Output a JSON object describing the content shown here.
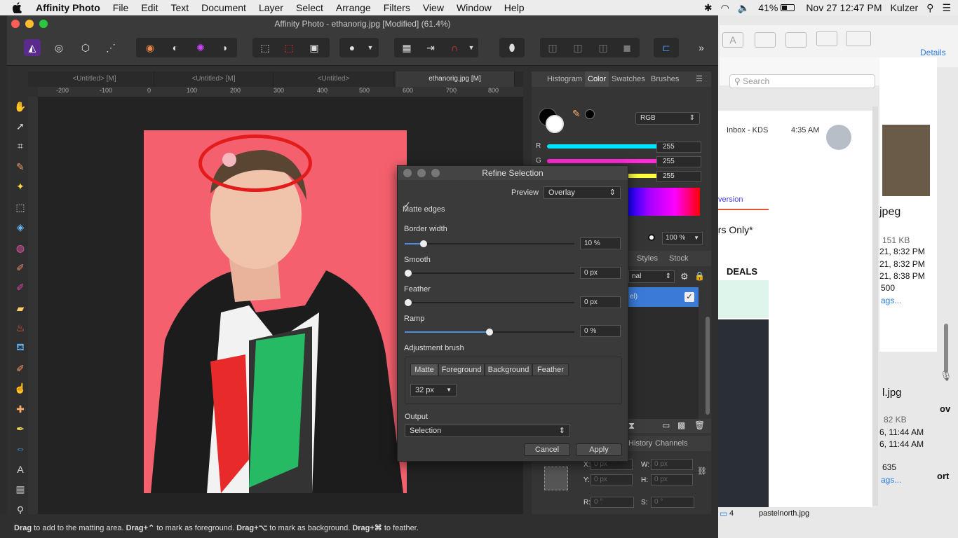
{
  "menubar": {
    "app_name": "Affinity Photo",
    "menus": [
      "File",
      "Edit",
      "Text",
      "Document",
      "Layer",
      "Select",
      "Arrange",
      "Filters",
      "View",
      "Window",
      "Help"
    ],
    "battery": "41%",
    "clock": "Nov 27  12:47 PM",
    "user": "Kulzer"
  },
  "window": {
    "title": "Affinity Photo - ethanorig.jpg [Modified] (61.4%)"
  },
  "doc_tabs": [
    "<Untitled> [M]",
    "<Untitled> [M]",
    "<Untitled>",
    "ethanorig.jpg [M]"
  ],
  "ruler": {
    "unit": "px",
    "ticks": [
      "-200",
      "-100",
      "0",
      "100",
      "200",
      "300",
      "400",
      "500",
      "600",
      "700",
      "800"
    ]
  },
  "color_panel": {
    "tabs": [
      "Histogram",
      "Color",
      "Swatches",
      "Brushes"
    ],
    "mode": "RGB",
    "channels": [
      {
        "label": "R",
        "value": "255",
        "color": "#00e5ff"
      },
      {
        "label": "G",
        "value": "255",
        "color": "#ff2bd6"
      },
      {
        "label": "B",
        "value": "255",
        "color": "#ffff40"
      }
    ],
    "opacity": "100 %"
  },
  "layers_panel": {
    "tabs": [
      "Styles",
      "Stock"
    ],
    "blend_fragment": "nal",
    "layer_fragment": "el)"
  },
  "transform_panel": {
    "tabs": [
      "History",
      "Channels"
    ],
    "x_label": "X:",
    "x_ph": "0 px",
    "y_label": "Y:",
    "y_ph": "0 px",
    "w_label": "W:",
    "w_ph": "0 px",
    "h_label": "H:",
    "h_ph": "0 px",
    "r_label": "R:",
    "r_ph": "0 °",
    "s_label": "S:",
    "s_ph": "0 °"
  },
  "refine": {
    "title": "Refine Selection",
    "preview_label": "Preview",
    "preview_value": "Overlay",
    "matte_edges": "Matte edges",
    "border_width": {
      "label": "Border width",
      "value": "10 %",
      "pos": 0.11
    },
    "smooth": {
      "label": "Smooth",
      "value": "0 px",
      "pos": 0.0
    },
    "feather": {
      "label": "Feather",
      "value": "0 px",
      "pos": 0.0
    },
    "ramp": {
      "label": "Ramp",
      "value": "0 %",
      "pos": 0.5
    },
    "adjustment_brush": "Adjustment brush",
    "brush_modes": [
      "Matte",
      "Foreground",
      "Background",
      "Feather"
    ],
    "brush_size": "32 px",
    "output_label": "Output",
    "output_value": "Selection",
    "cancel": "Cancel",
    "apply": "Apply"
  },
  "status": {
    "b1": "Drag",
    "t1": " to add to the matting area. ",
    "b2": "Drag+⌃",
    "t2": " to mark as foreground. ",
    "b3": "Drag+⌥",
    "t3": " to mark as background. ",
    "b4": "Drag+⌘",
    "t4": " to feather."
  },
  "mail": {
    "details": "Details",
    "search": "Search",
    "inbox": "Inbox - KDS",
    "time": "4:35 AM",
    "version": "version",
    "only": "ers Only*",
    "deals": "DEALS",
    "file1": "jpeg",
    "size1": "151 KB",
    "d1": "21, 8:32 PM",
    "d2": "21, 8:32 PM",
    "d3": "21, 8:38 PM",
    "n1": "500",
    "tags1": "ags...",
    "file2": "l.jpg",
    "size2": "82 KB",
    "d4": "6, 11:44 AM",
    "d5": "6, 11:44 AM",
    "n2": "635",
    "tags2": "ags...",
    "side1": "ov",
    "side2": "ort",
    "crumb_num": "4",
    "crumb_file": "pastelnorth.jpg"
  }
}
